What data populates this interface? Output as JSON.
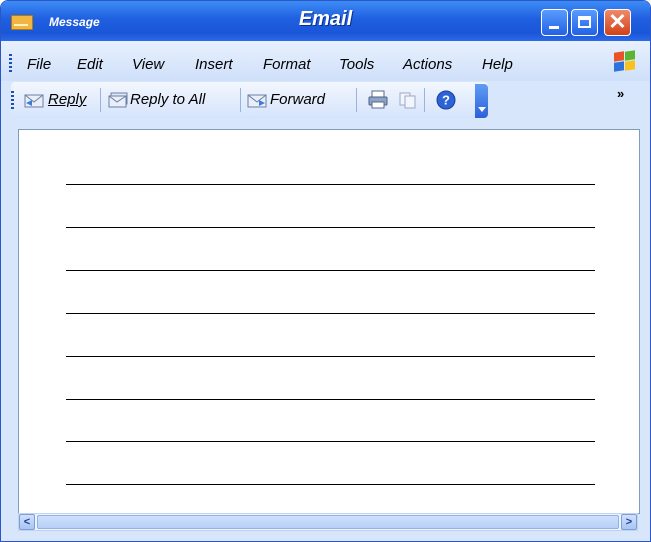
{
  "window": {
    "app_name": "Message",
    "title": "Email",
    "controls": {
      "minimize": "minimize",
      "maximize": "maximize",
      "close": "close"
    }
  },
  "menu": {
    "items": [
      "File",
      "Edit",
      "View",
      "Insert",
      "Format",
      "Tools",
      "Actions",
      "Help"
    ],
    "overflow_label": "»"
  },
  "toolbar": {
    "reply_label": "Reply",
    "reply_all_label": "Reply to All",
    "forward_label": "Forward",
    "icons": [
      "reply-envelope-icon",
      "reply-all-envelope-icon",
      "forward-envelope-icon",
      "print-icon",
      "copy-icon",
      "help-icon"
    ]
  },
  "message_body": {
    "ruled_lines": 8
  },
  "scrollbar": {
    "left_arrow": "<",
    "right_arrow": ">"
  },
  "colors": {
    "titlebar": "#1f5fe0",
    "close_button": "#d0411a",
    "toolbar_bg": "#d6e4fb",
    "window_bg": "#d8e6fb"
  }
}
